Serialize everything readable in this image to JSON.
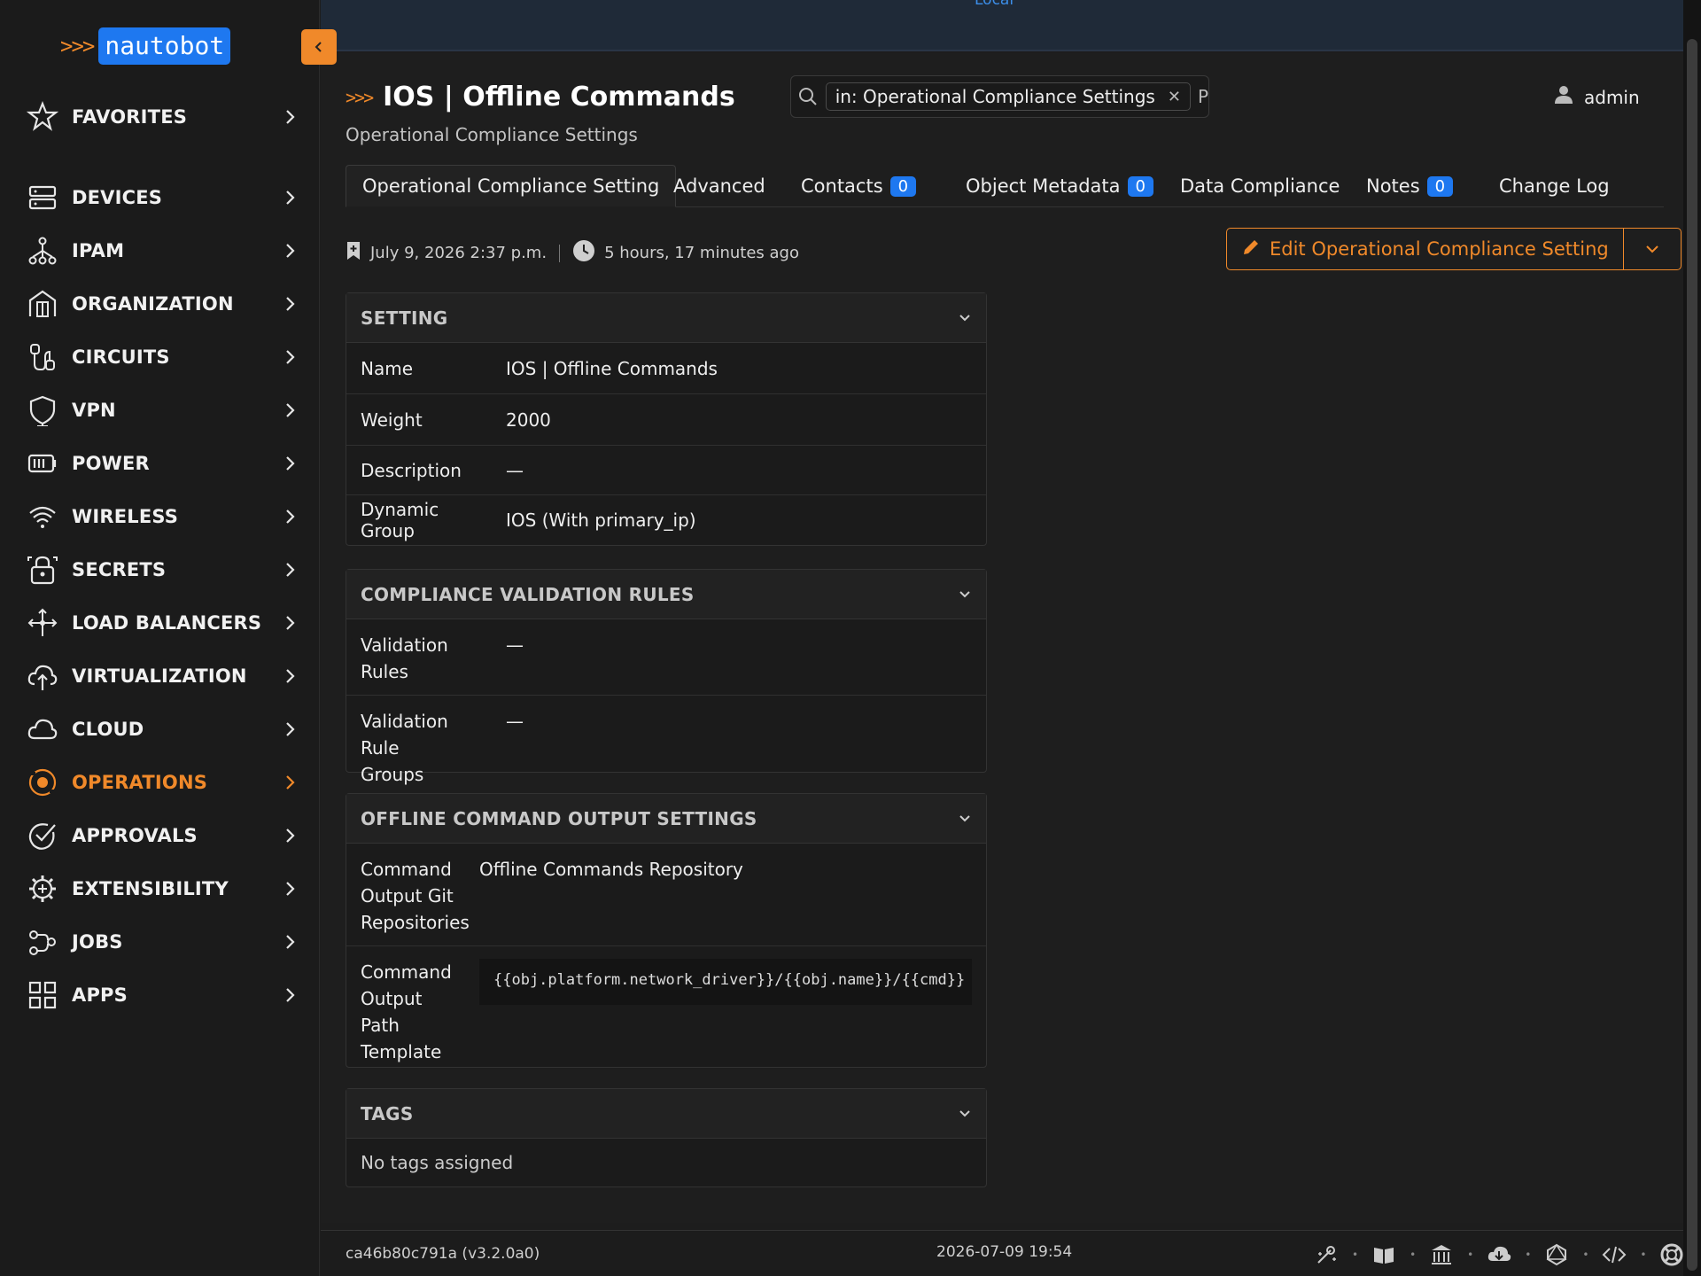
{
  "app": {
    "logo_text": "nautobot",
    "logo_chevrons": ">>>",
    "collapse_label": "‹"
  },
  "topbar": {
    "env_label": "Local"
  },
  "sidebar": {
    "items": [
      {
        "label": "FAVORITES",
        "icon": "star-icon"
      },
      {
        "label": "DEVICES",
        "icon": "server-icon"
      },
      {
        "label": "IPAM",
        "icon": "network-tree-icon"
      },
      {
        "label": "ORGANIZATION",
        "icon": "building-icon"
      },
      {
        "label": "CIRCUITS",
        "icon": "cable-icon"
      },
      {
        "label": "VPN",
        "icon": "shield-icon"
      },
      {
        "label": "POWER",
        "icon": "battery-icon"
      },
      {
        "label": "WIRELESS",
        "icon": "wifi-icon"
      },
      {
        "label": "SECRETS",
        "icon": "lock-icon"
      },
      {
        "label": "LOAD BALANCERS",
        "icon": "arrows-split-icon"
      },
      {
        "label": "VIRTUALIZATION",
        "icon": "cloud-upload-icon"
      },
      {
        "label": "CLOUD",
        "icon": "cloud-icon"
      },
      {
        "label": "OPERATIONS",
        "icon": "target-icon",
        "active": true
      },
      {
        "label": "APPROVALS",
        "icon": "check-circle-icon"
      },
      {
        "label": "EXTENSIBILITY",
        "icon": "gear-plus-icon"
      },
      {
        "label": "JOBS",
        "icon": "workflow-icon"
      },
      {
        "label": "APPS",
        "icon": "grid-icon"
      }
    ],
    "accent": "#f0892a"
  },
  "header": {
    "title_chevrons": ">>>",
    "title": "IOS | Offline Commands",
    "subtitle": "Operational Compliance Settings",
    "search": {
      "chip": "in: Operational Compliance Settings",
      "typed": "P"
    },
    "user": "admin"
  },
  "tabs": [
    {
      "label": "Operational Compliance Setting",
      "active": true
    },
    {
      "label": "Advanced"
    },
    {
      "label": "Contacts",
      "badge": "0"
    },
    {
      "label": "Object Metadata",
      "badge": "0"
    },
    {
      "label": "Data Compliance"
    },
    {
      "label": "Notes",
      "badge": "0"
    },
    {
      "label": "Change Log"
    }
  ],
  "meta": {
    "created": "July 9, 2026 2:37 p.m.",
    "updated": "5 hours, 17 minutes ago"
  },
  "edit_button": "Edit Operational Compliance Setting",
  "panels": {
    "setting": {
      "title": "SETTING",
      "name_label": "Name",
      "name_value": "IOS | Offline Commands",
      "weight_label": "Weight",
      "weight_value": "2000",
      "description_label": "Description",
      "description_value": "—",
      "dynamic_group_label": "Dynamic Group",
      "dynamic_group_value": "IOS (With primary_ip)"
    },
    "validation": {
      "title": "COMPLIANCE VALIDATION RULES",
      "rules_label_1": "Validation",
      "rules_label_2": "Rules",
      "rules_value": "—",
      "groups_label_1": "Validation Rule",
      "groups_label_2": "Groups",
      "groups_value": "—"
    },
    "offline": {
      "title": "OFFLINE COMMAND OUTPUT SETTINGS",
      "repo_label_1": "Command",
      "repo_label_2": "Output Git",
      "repo_label_3": "Repositories",
      "repo_value": "Offline Commands Repository",
      "path_label_1": "Command",
      "path_label_2": "Output Path",
      "path_label_3": "Template",
      "path_value": "{{obj.platform.network_driver}}/{{obj.name}}/{{cmd}}"
    },
    "tags": {
      "title": "TAGS",
      "empty": "No tags assigned"
    }
  },
  "footer": {
    "version": "ca46b80c791a (v3.2.0a0)",
    "datetime": "2026-07-09 19:54"
  }
}
